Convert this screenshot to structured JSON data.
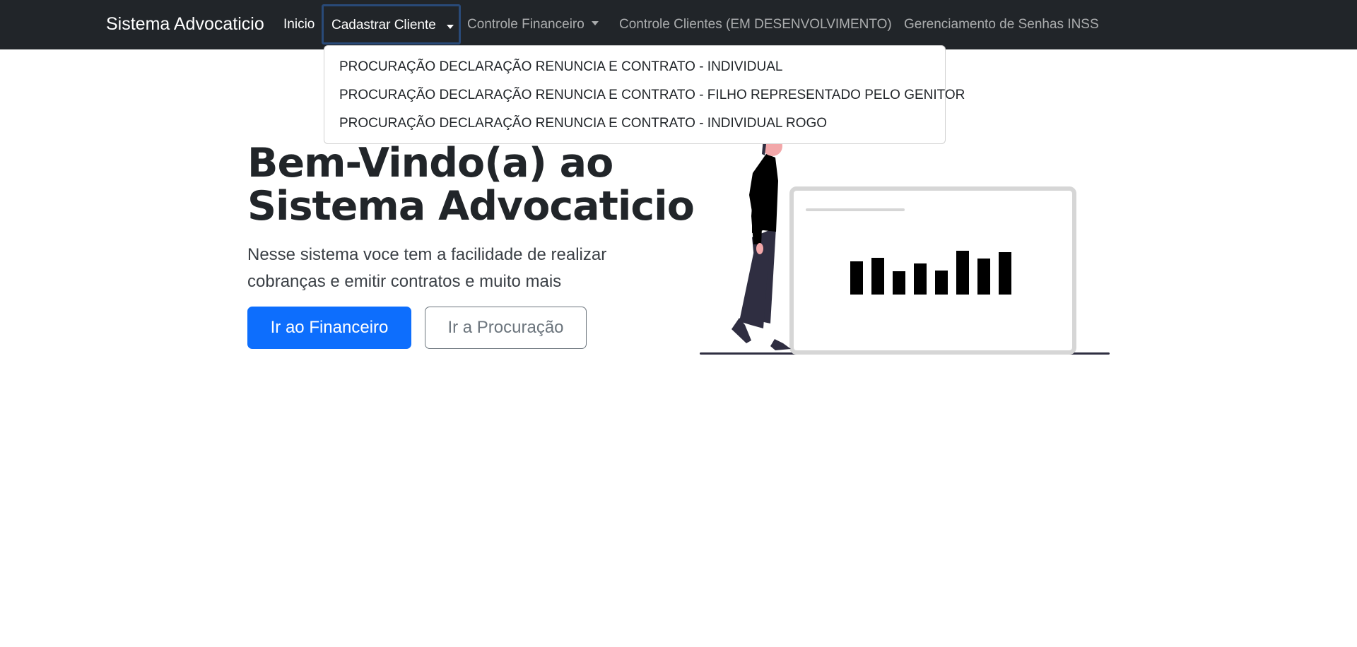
{
  "navbar": {
    "brand": "Sistema Advocaticio",
    "items": [
      {
        "label": "Inicio"
      },
      {
        "label": "Cadastrar Cliente"
      },
      {
        "label": "Controle Financeiro"
      },
      {
        "label": "Controle Clientes (EM DESENVOLVIMENTO)"
      },
      {
        "label": "Gerenciamento de Senhas INSS"
      }
    ]
  },
  "dropdown": {
    "items": [
      {
        "label": "PROCURAÇÃO DECLARAÇÃO RENUNCIA E CONTRATO - INDIVIDUAL"
      },
      {
        "label": "PROCURAÇÃO DECLARAÇÃO RENUNCIA E CONTRATO - FILHO REPRESENTADO PELO GENITOR"
      },
      {
        "label": "PROCURAÇÃO DECLARAÇÃO RENUNCIA E CONTRATO - INDIVIDUAL ROGO"
      }
    ]
  },
  "hero": {
    "title_line1": "Bem-Vindo(a) ao",
    "title_line2": "Sistema Advocaticio",
    "lead": "Nesse sistema voce tem a facilidade de realizar cobranças e emitir contratos e muito mais",
    "primary_button": "Ir ao Financeiro",
    "secondary_button": "Ir a Procuração"
  },
  "icons": {
    "dropdown_caret": "caret-down-icon",
    "illustration": "person-walking-bar-chart-screen-illustration"
  },
  "colors": {
    "navbar_bg": "#212529",
    "primary": "#0d6efd",
    "outline": "#6c757d",
    "focus_border": "#294a78"
  }
}
